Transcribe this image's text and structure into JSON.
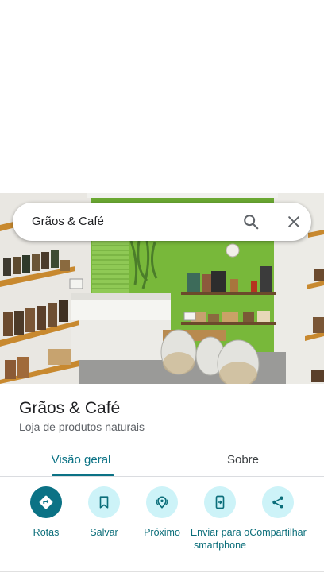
{
  "search": {
    "query": "Grãos & Café"
  },
  "place": {
    "name": "Grãos & Café",
    "category": "Loja de produtos naturais"
  },
  "tabs": [
    {
      "label": "Visão geral",
      "active": true
    },
    {
      "label": "Sobre",
      "active": false
    }
  ],
  "actions": [
    {
      "label": "Rotas",
      "icon": "directions-icon",
      "primary": true
    },
    {
      "label": "Salvar",
      "icon": "bookmark-icon",
      "primary": false
    },
    {
      "label": "Próximo",
      "icon": "nearby-icon",
      "primary": false
    },
    {
      "label": "Enviar para o smartphone",
      "icon": "send-to-phone-icon",
      "primary": false
    },
    {
      "label": "Compartilhar",
      "icon": "share-icon",
      "primary": false
    }
  ],
  "colors": {
    "accent": "#0b7285",
    "chip_bg": "#cdf3f8",
    "wall_green": "#7cb342"
  }
}
